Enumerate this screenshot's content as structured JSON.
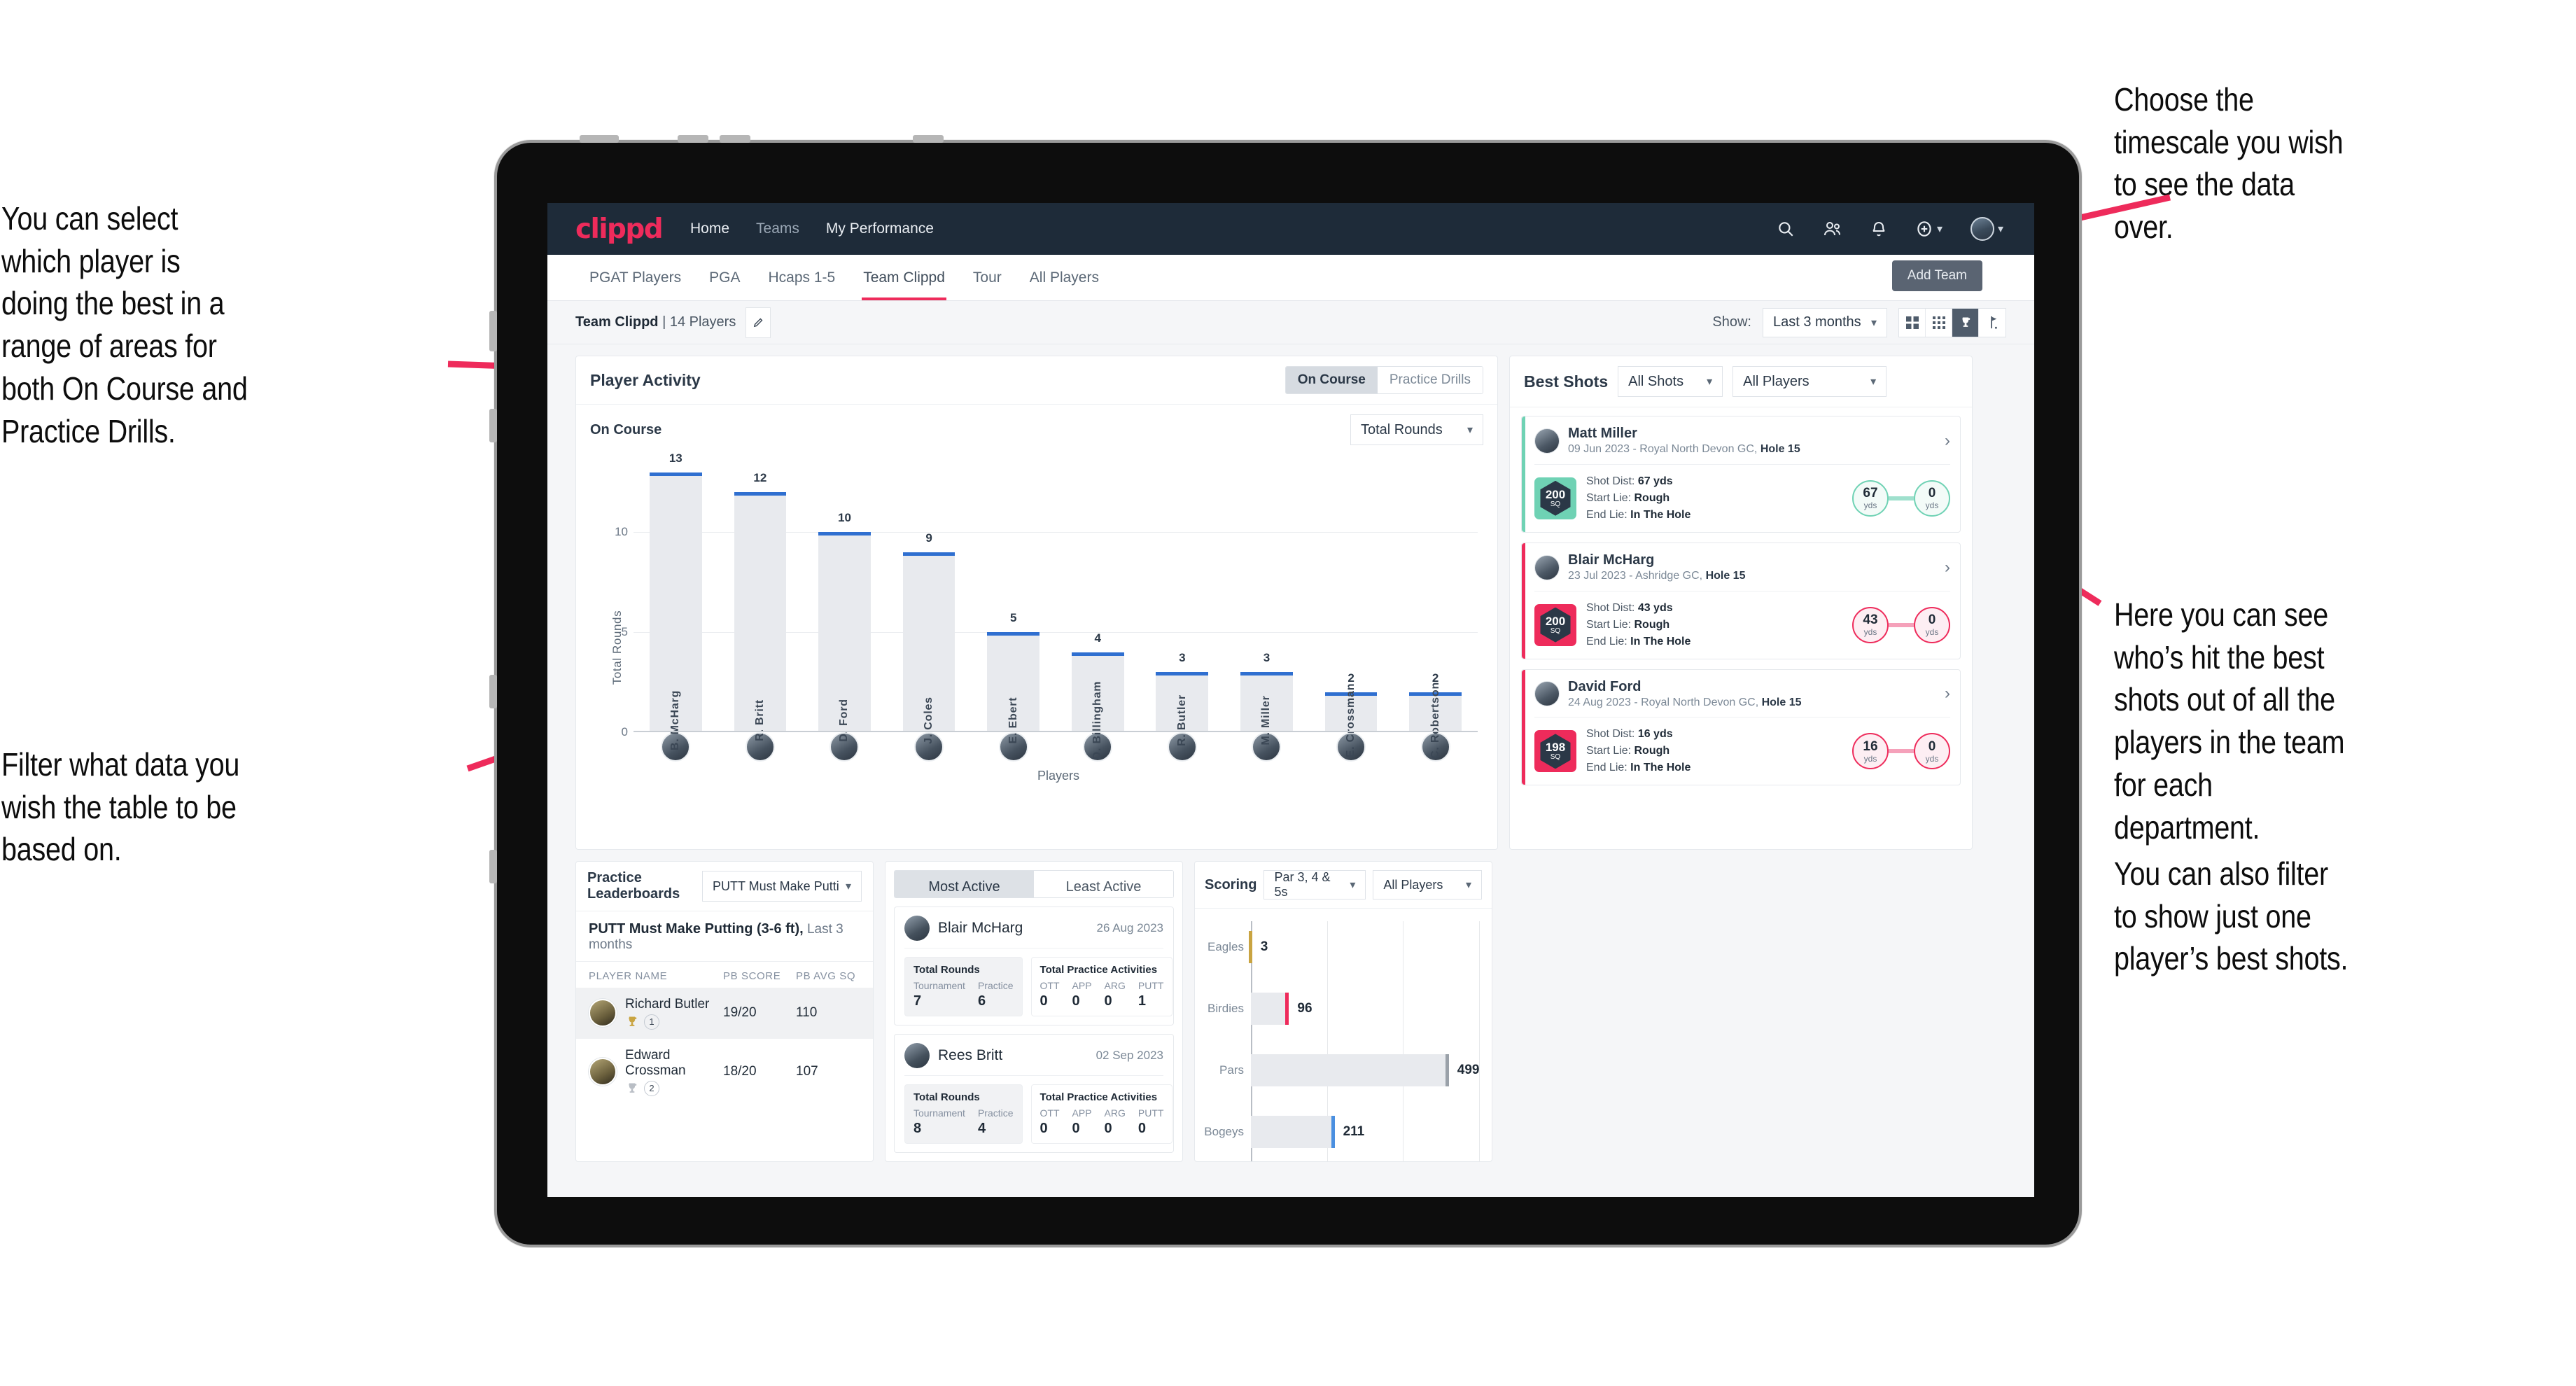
{
  "annotations": {
    "left_top": "You can select which player is doing the best in a range of areas for both On Course and Practice Drills.",
    "left_bottom": "Filter what data you wish the table to be based on.",
    "right_top": "Choose the timescale you wish to see the data over.",
    "right_mid_1": "Here you can see who’s hit the best shots out of all the players in the team for each department.",
    "right_mid_2": "You can also filter to show just one player’s best shots."
  },
  "navbar": {
    "logo": "clippd",
    "links": [
      {
        "label": "Home",
        "active": true
      },
      {
        "label": "Teams",
        "active": false
      },
      {
        "label": "My Performance",
        "active": true
      }
    ],
    "icons": [
      "search-icon",
      "people-icon",
      "bell-icon",
      "plus-circle-icon",
      "avatar"
    ]
  },
  "tabs": {
    "items": [
      "PGAT Players",
      "PGA",
      "Hcaps 1-5",
      "Team Clippd",
      "Tour",
      "All Players"
    ],
    "active": "Team Clippd",
    "tooltip": "Add Team"
  },
  "subbar": {
    "team_name": "Team Clippd",
    "team_count": "| 14 Players",
    "show_label": "Show:",
    "timescale": "Last 3 months",
    "view_icons": [
      "grid-large-icon",
      "grid-small-icon",
      "trophy-icon",
      "flag-icon"
    ],
    "active_view": "trophy-icon"
  },
  "player_activity": {
    "title": "Player Activity",
    "segments": [
      "On Course",
      "Practice Drills"
    ],
    "active_segment": "On Course",
    "sub_label": "On Course",
    "metric_select": "Total Rounds"
  },
  "chart_data": [
    {
      "type": "bar",
      "title": "Player Activity - On Course",
      "xlabel": "Players",
      "ylabel": "Total Rounds",
      "ylim": [
        0,
        14
      ],
      "yticks": [
        0,
        5,
        10
      ],
      "grid": true,
      "categories": [
        "B. McHarg",
        "R. Britt",
        "D. Ford",
        "J. Coles",
        "E. Ebert",
        "D. Billingham",
        "R. Butler",
        "M. Miller",
        "E. Crossman",
        "C. Robertson"
      ],
      "values": [
        13,
        12,
        10,
        9,
        5,
        4,
        3,
        3,
        2,
        2
      ],
      "bar_color": "#e8eaee",
      "cap_color": "#2f6fd0"
    },
    {
      "type": "bar",
      "orientation": "horizontal",
      "title": "Scoring",
      "xlabel": "",
      "ylabel": "",
      "categories": [
        "Eagles",
        "Birdies",
        "Pars",
        "Bogeys"
      ],
      "values": [
        3,
        96,
        499,
        211
      ],
      "xlim": [
        0,
        600
      ],
      "grid": true,
      "cap_colors": [
        "#c9a441",
        "#ee2b5b",
        "#9aa1a9",
        "#4a8fe0"
      ]
    }
  ],
  "best_shots": {
    "title": "Best Shots",
    "filter_shots": "All Shots",
    "filter_players": "All Players",
    "shots": [
      {
        "player": "Matt Miller",
        "meta_plain": "09 Jun 2023 - Royal North Devon GC, ",
        "meta_bold": "Hole 15",
        "sq": "200",
        "sq_unit": "SQ",
        "accent": "teal",
        "shot_dist_label": "Shot Dist:",
        "shot_dist": "67 yds",
        "start_lie_label": "Start Lie:",
        "start_lie": "Rough",
        "end_lie_label": "End Lie:",
        "end_lie": "In The Hole",
        "from_value": "67",
        "from_unit": "yds",
        "to_value": "0",
        "to_unit": "yds"
      },
      {
        "player": "Blair McHarg",
        "meta_plain": "23 Jul 2023 - Ashridge GC, ",
        "meta_bold": "Hole 15",
        "sq": "200",
        "sq_unit": "SQ",
        "accent": "pink",
        "shot_dist_label": "Shot Dist:",
        "shot_dist": "43 yds",
        "start_lie_label": "Start Lie:",
        "start_lie": "Rough",
        "end_lie_label": "End Lie:",
        "end_lie": "In The Hole",
        "from_value": "43",
        "from_unit": "yds",
        "to_value": "0",
        "to_unit": "yds"
      },
      {
        "player": "David Ford",
        "meta_plain": "24 Aug 2023 - Royal North Devon GC, ",
        "meta_bold": "Hole 15",
        "sq": "198",
        "sq_unit": "SQ",
        "accent": "pink",
        "shot_dist_label": "Shot Dist:",
        "shot_dist": "16 yds",
        "start_lie_label": "Start Lie:",
        "start_lie": "Rough",
        "end_lie_label": "End Lie:",
        "end_lie": "In The Hole",
        "from_value": "16",
        "from_unit": "yds",
        "to_value": "0",
        "to_unit": "yds"
      }
    ]
  },
  "practice_leaderboards": {
    "title": "Practice Leaderboards",
    "drill_select": "PUTT Must Make Putting ...",
    "subtitle_bold": "PUTT Must Make Putting (3-6 ft),",
    "subtitle_plain": " Last 3 months",
    "columns": [
      "PLAYER NAME",
      "PB SCORE",
      "PB AVG SQ"
    ],
    "rows": [
      {
        "name": "Richard Butler",
        "rank": "1",
        "trophy": "gold",
        "pb_score": "19/20",
        "pb_avg_sq": "110"
      },
      {
        "name": "Edward Crossman",
        "rank": "2",
        "trophy": "silver",
        "pb_score": "18/20",
        "pb_avg_sq": "107"
      }
    ]
  },
  "activity": {
    "tabs": [
      "Most Active",
      "Least Active"
    ],
    "active_tab": "Most Active",
    "rounds_heading": "Total Rounds",
    "rounds_cols": [
      "Tournament",
      "Practice"
    ],
    "practice_heading": "Total Practice Activities",
    "practice_cols": [
      "OTT",
      "APP",
      "ARG",
      "PUTT"
    ],
    "cards": [
      {
        "name": "Blair McHarg",
        "date": "26 Aug 2023",
        "rounds": [
          "7",
          "6"
        ],
        "practice": [
          "0",
          "0",
          "0",
          "1"
        ]
      },
      {
        "name": "Rees Britt",
        "date": "02 Sep 2023",
        "rounds": [
          "8",
          "4"
        ],
        "practice": [
          "0",
          "0",
          "0",
          "0"
        ]
      }
    ]
  },
  "scoring": {
    "title": "Scoring",
    "filter_par": "Par 3, 4 & 5s",
    "filter_players": "All Players"
  },
  "colors": {
    "brand_pink": "#ee2b5b",
    "navbar": "#1e2b39",
    "teal": "#6fd2b4",
    "bar_cap_blue": "#2f6fd0",
    "page_bg": "#f5f6f8"
  }
}
